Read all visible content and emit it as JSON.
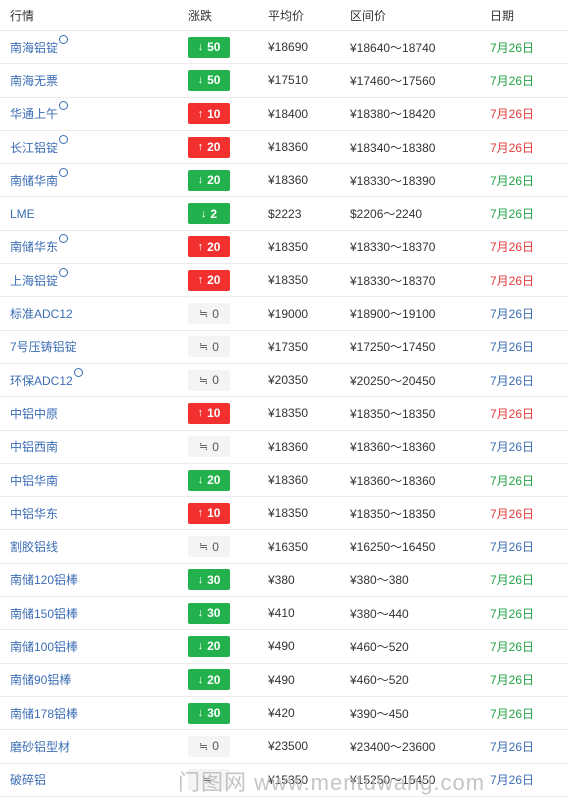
{
  "headers": {
    "name": "行情",
    "change": "涨跌",
    "avg": "平均价",
    "range": "区间价",
    "date": "日期"
  },
  "rows": [
    {
      "name": "南海铝锭",
      "sup": true,
      "dir": "down",
      "change": "50",
      "avg": "¥18690",
      "range": "¥18640～18740",
      "date": "7月26日",
      "date_color": "green"
    },
    {
      "name": "南海无票",
      "sup": false,
      "dir": "down",
      "change": "50",
      "avg": "¥17510",
      "range": "¥17460～17560",
      "date": "7月26日",
      "date_color": "green"
    },
    {
      "name": "华通上午",
      "sup": true,
      "dir": "up",
      "change": "10",
      "avg": "¥18400",
      "range": "¥18380～18420",
      "date": "7月26日",
      "date_color": "red"
    },
    {
      "name": "长江铝锭",
      "sup": true,
      "dir": "up",
      "change": "20",
      "avg": "¥18360",
      "range": "¥18340～18380",
      "date": "7月26日",
      "date_color": "red"
    },
    {
      "name": "南储华南",
      "sup": true,
      "dir": "down",
      "change": "20",
      "avg": "¥18360",
      "range": "¥18330～18390",
      "date": "7月26日",
      "date_color": "green"
    },
    {
      "name": "LME",
      "sup": false,
      "dir": "down",
      "change": "2",
      "avg": "$2223",
      "range": "$2206～2240",
      "date": "7月26日",
      "date_color": "green"
    },
    {
      "name": "南储华东",
      "sup": true,
      "dir": "up",
      "change": "20",
      "avg": "¥18350",
      "range": "¥18330～18370",
      "date": "7月26日",
      "date_color": "red"
    },
    {
      "name": "上海铝锭",
      "sup": true,
      "dir": "up",
      "change": "20",
      "avg": "¥18350",
      "range": "¥18330～18370",
      "date": "7月26日",
      "date_color": "red"
    },
    {
      "name": "标准ADC12",
      "sup": false,
      "dir": "flat",
      "change": "0",
      "avg": "¥19000",
      "range": "¥18900～19100",
      "date": "7月26日",
      "date_color": "blue"
    },
    {
      "name": "7号压铸铝锭",
      "sup": false,
      "dir": "flat",
      "change": "0",
      "avg": "¥17350",
      "range": "¥17250～17450",
      "date": "7月26日",
      "date_color": "blue"
    },
    {
      "name": "环保ADC12",
      "sup": true,
      "dir": "flat",
      "change": "0",
      "avg": "¥20350",
      "range": "¥20250～20450",
      "date": "7月26日",
      "date_color": "blue"
    },
    {
      "name": "中铝中原",
      "sup": false,
      "dir": "up",
      "change": "10",
      "avg": "¥18350",
      "range": "¥18350～18350",
      "date": "7月26日",
      "date_color": "red"
    },
    {
      "name": "中铝西南",
      "sup": false,
      "dir": "flat",
      "change": "0",
      "avg": "¥18360",
      "range": "¥18360～18360",
      "date": "7月26日",
      "date_color": "blue"
    },
    {
      "name": "中铝华南",
      "sup": false,
      "dir": "down",
      "change": "20",
      "avg": "¥18360",
      "range": "¥18360～18360",
      "date": "7月26日",
      "date_color": "green"
    },
    {
      "name": "中铝华东",
      "sup": false,
      "dir": "up",
      "change": "10",
      "avg": "¥18350",
      "range": "¥18350～18350",
      "date": "7月26日",
      "date_color": "red"
    },
    {
      "name": "割胶铝线",
      "sup": false,
      "dir": "flat",
      "change": "0",
      "avg": "¥16350",
      "range": "¥16250～16450",
      "date": "7月26日",
      "date_color": "blue"
    },
    {
      "name": "南储120铝棒",
      "sup": false,
      "dir": "down",
      "change": "30",
      "avg": "¥380",
      "range": "¥380～380",
      "date": "7月26日",
      "date_color": "green"
    },
    {
      "name": "南储150铝棒",
      "sup": false,
      "dir": "down",
      "change": "30",
      "avg": "¥410",
      "range": "¥380～440",
      "date": "7月26日",
      "date_color": "green"
    },
    {
      "name": "南储100铝棒",
      "sup": false,
      "dir": "down",
      "change": "20",
      "avg": "¥490",
      "range": "¥460～520",
      "date": "7月26日",
      "date_color": "green"
    },
    {
      "name": "南储90铝棒",
      "sup": false,
      "dir": "down",
      "change": "20",
      "avg": "¥490",
      "range": "¥460～520",
      "date": "7月26日",
      "date_color": "green"
    },
    {
      "name": "南储178铝棒",
      "sup": false,
      "dir": "down",
      "change": "30",
      "avg": "¥420",
      "range": "¥390～450",
      "date": "7月26日",
      "date_color": "green"
    },
    {
      "name": "磨砂铝型材",
      "sup": false,
      "dir": "flat",
      "change": "0",
      "avg": "¥23500",
      "range": "¥23400～23600",
      "date": "7月26日",
      "date_color": "blue"
    },
    {
      "name": "破碎铝",
      "sup": false,
      "dir": "flat",
      "change": "",
      "avg": "¥15350",
      "range": "¥15250～15450",
      "date": "7月26日",
      "date_color": "blue"
    }
  ],
  "arrows": {
    "up": "↑",
    "down": "↓",
    "flat": "≒"
  },
  "colors": {
    "green": "#22b14c",
    "red": "#f23030",
    "link": "#3b6db5"
  },
  "watermark": "门图网 www.mentuwang.com"
}
